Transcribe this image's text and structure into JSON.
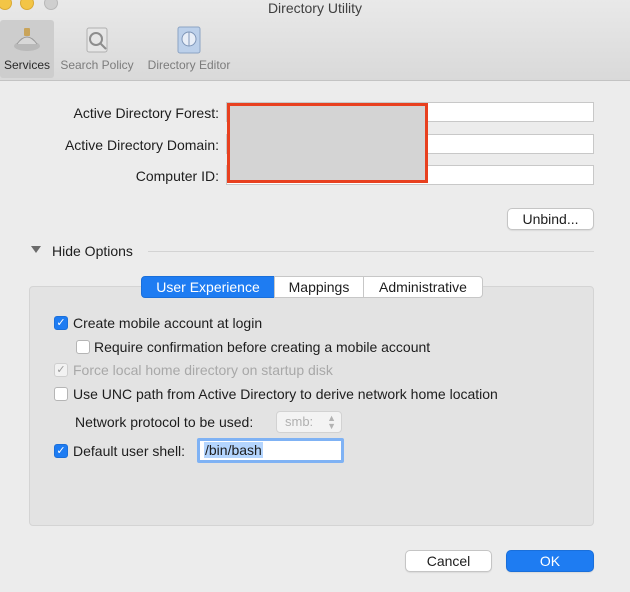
{
  "window": {
    "title": "Directory Utility"
  },
  "toolbar": {
    "items": [
      {
        "label": "Services",
        "icon": "services-icon"
      },
      {
        "label": "Search Policy",
        "icon": "search-policy-icon"
      },
      {
        "label": "Directory Editor",
        "icon": "directory-editor-icon"
      }
    ]
  },
  "form": {
    "forest_label": "Active Directory Forest:",
    "domain_label": "Active Directory Domain:",
    "computer_id_label": "Computer ID:",
    "unbind_label": "Unbind..."
  },
  "options": {
    "toggle_label": "Hide Options",
    "tabs": [
      "User Experience",
      "Mappings",
      "Administrative"
    ],
    "create_mobile": "Create mobile account at login",
    "require_confirmation": "Require confirmation before creating a mobile account",
    "force_local": "Force local home directory on startup disk",
    "use_unc": "Use UNC path from Active Directory to derive network home location",
    "protocol_label": "Network protocol to be used:",
    "protocol_value": "smb:",
    "default_shell_label": "Default user shell:",
    "default_shell_value": "/bin/bash"
  },
  "footer": {
    "cancel_label": "Cancel",
    "ok_label": "OK"
  },
  "colors": {
    "accent": "#1e7cf2",
    "redaction_border": "#e8401f"
  }
}
